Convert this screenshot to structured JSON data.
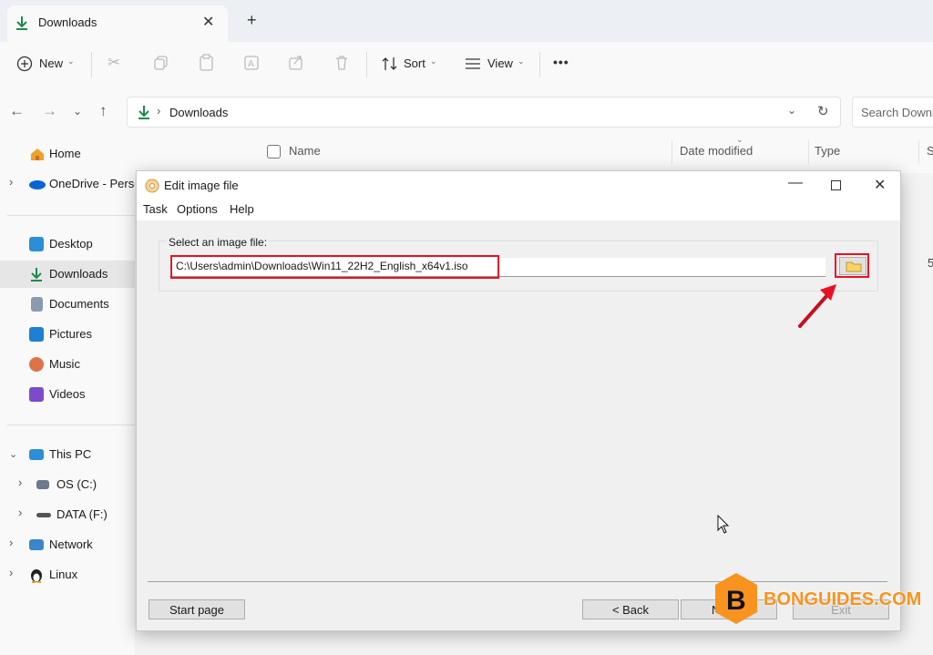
{
  "explorer": {
    "tab": {
      "title": "Downloads"
    },
    "toolbar": {
      "new_label": "New",
      "sort_label": "Sort",
      "view_label": "View",
      "more_label": "•••"
    },
    "address": {
      "path": "Downloads",
      "search_placeholder": "Search Downlo"
    },
    "sidebar": {
      "home": "Home",
      "onedrive": "OneDrive - Person",
      "desktop": "Desktop",
      "downloads": "Downloads",
      "documents": "Documents",
      "pictures": "Pictures",
      "music": "Music",
      "videos": "Videos",
      "this_pc": "This PC",
      "os_c": "OS (C:)",
      "data_f": "DATA (F:)",
      "network": "Network",
      "linux": "Linux"
    },
    "columns": {
      "name": "Name",
      "date_modified": "Date modified",
      "type": "Type",
      "size_partial": "S"
    },
    "right_edge_partial": "5"
  },
  "dialog": {
    "title": "Edit image file",
    "menu": {
      "task": "Task",
      "options": "Options",
      "help": "Help"
    },
    "select_label": "Select an image file:",
    "file_path": "C:\\Users\\admin\\Downloads\\Win11_22H2_English_x64v1.iso",
    "buttons": {
      "start_page": "Start page",
      "back": "< Back",
      "next": "Next >",
      "exit": "Exit"
    }
  },
  "watermark": {
    "letter": "B",
    "text": "BONGUIDES.COM"
  },
  "colors": {
    "highlight": "#e81123",
    "accent": "#0f7b0f",
    "watermark": "#f7931e"
  }
}
